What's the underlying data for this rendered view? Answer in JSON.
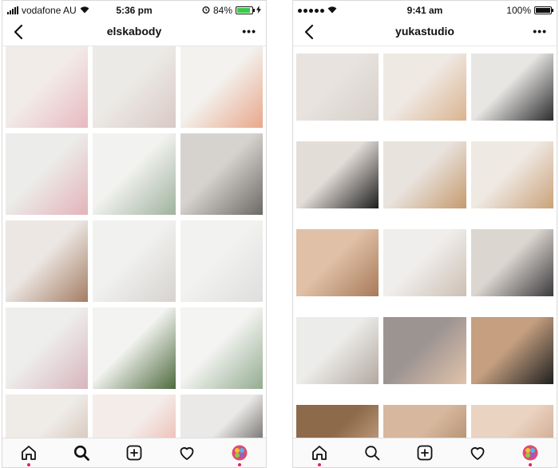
{
  "left": {
    "status": {
      "carrier": "vodafone AU",
      "time": "5:36 pm",
      "battery": "84%"
    },
    "profile": {
      "username": "elskabody"
    },
    "more_label": "•••",
    "tiles": [
      {
        "name": "flowers-in-glass-tile",
        "colors": [
          "#f2ece8",
          "#e7b9c0"
        ]
      },
      {
        "name": "floral-cards-tile",
        "colors": [
          "#eceae6",
          "#d9c9c5"
        ]
      },
      {
        "name": "three-vases-tile",
        "colors": [
          "#f3f2ef",
          "#e9a78a"
        ]
      },
      {
        "name": "floral-notebook-tile",
        "colors": [
          "#ececea",
          "#e3b3b9"
        ]
      },
      {
        "name": "eucalyptus-vase-tile",
        "colors": [
          "#f2f2f0",
          "#9fb39d"
        ]
      },
      {
        "name": "letter-board-tile",
        "colors": [
          "#d6d3cf",
          "#6c6a66"
        ]
      },
      {
        "name": "books-tray-tile",
        "colors": [
          "#ece7e3",
          "#a47d63"
        ]
      },
      {
        "name": "heart-dish-tile",
        "colors": [
          "#f1f1ef",
          "#d6d3d0"
        ]
      },
      {
        "name": "white-cup-tile",
        "colors": [
          "#f2f2f0",
          "#dedede"
        ]
      },
      {
        "name": "skincare-boxes-tile",
        "colors": [
          "#eeeeec",
          "#d7b5bd"
        ]
      },
      {
        "name": "plant-sign-tile",
        "colors": [
          "#f3f3f1",
          "#4e6b3e"
        ]
      },
      {
        "name": "eucalyptus-branch-tile",
        "colors": [
          "#f4f4f2",
          "#93ac8f"
        ]
      },
      {
        "name": "bowls-tile",
        "colors": [
          "#efebe7",
          "#c9b3a1"
        ]
      },
      {
        "name": "peony-tile",
        "colors": [
          "#f4ece8",
          "#e8a69a"
        ]
      },
      {
        "name": "coffee-tile",
        "colors": [
          "#eae9e7",
          "#2e2a27"
        ]
      }
    ]
  },
  "right": {
    "status": {
      "time": "9:41 am",
      "battery": "100%"
    },
    "profile": {
      "username": "yukastudio"
    },
    "more_label": "•••",
    "tiles": [
      {
        "name": "ring-necklace-tile",
        "colors": [
          "#e8e3df",
          "#d6cfc9"
        ]
      },
      {
        "name": "gold-rings-hand-tile",
        "colors": [
          "#efe9e4",
          "#d9b48f"
        ]
      },
      {
        "name": "blazer-brooch-tile",
        "colors": [
          "#e7e6e3",
          "#2c2c2e"
        ]
      },
      {
        "name": "black-top-necklace-tile",
        "colors": [
          "#e3ddd8",
          "#1e1e1e"
        ]
      },
      {
        "name": "earring-profile-tile",
        "colors": [
          "#e9e3de",
          "#c69a6f"
        ]
      },
      {
        "name": "hand-dried-flowers-tile",
        "colors": [
          "#efe9e3",
          "#caa27a"
        ]
      },
      {
        "name": "ear-cuff-tile",
        "colors": [
          "#e0c0a6",
          "#a87a59"
        ]
      },
      {
        "name": "pendants-wall-tile",
        "colors": [
          "#f0eeec",
          "#cdbfb3"
        ]
      },
      {
        "name": "model-portrait-tile",
        "colors": [
          "#dcd6d0",
          "#3a3a3c"
        ]
      },
      {
        "name": "stone-pendants-tile",
        "colors": [
          "#ececea",
          "#b3a8a0"
        ]
      },
      {
        "name": "bracelet-wrist-tile",
        "colors": [
          "#9c9491",
          "#e2c3ab"
        ]
      },
      {
        "name": "circle-necklace-tile",
        "colors": [
          "#c59f80",
          "#1f1f1f"
        ]
      },
      {
        "name": "hand-rings-tile",
        "colors": [
          "#8d6a4a",
          "#d8b596"
        ]
      },
      {
        "name": "earring-close-tile",
        "colors": [
          "#d7b79d",
          "#a47e5d"
        ]
      },
      {
        "name": "finger-ring-tile",
        "colors": [
          "#ead3c1",
          "#c2967a"
        ]
      }
    ]
  }
}
